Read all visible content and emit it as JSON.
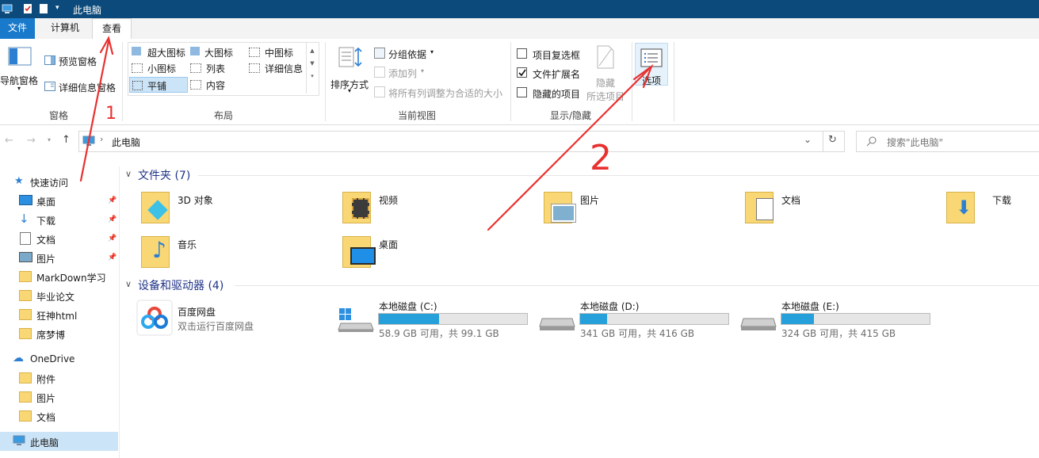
{
  "window": {
    "title": "此电脑"
  },
  "tabs": [
    "文件",
    "计算机",
    "查看"
  ],
  "ribbon": {
    "panes": {
      "nav_pane": "导航窗格",
      "preview_pane": "预览窗格",
      "details_pane": "详细信息窗格",
      "label": "窗格"
    },
    "layout": {
      "items": [
        "超大图标",
        "大图标",
        "中图标",
        "小图标",
        "列表",
        "详细信息",
        "平铺",
        "内容"
      ],
      "label": "布局"
    },
    "current_view": {
      "sort_by": "排序方式",
      "group_by": "分组依据",
      "add_columns": "添加列",
      "fit_columns": "将所有列调整为合适的大小",
      "label": "当前视图"
    },
    "show_hide": {
      "item_checkboxes": "项目复选框",
      "file_extensions": "文件扩展名",
      "hidden_items": "隐藏的项目",
      "hide_selected_1": "隐藏",
      "hide_selected_2": "所选项目",
      "label": "显示/隐藏"
    },
    "options": "选项"
  },
  "address": {
    "path": "此电脑",
    "search_placeholder": "搜索\"此电脑\""
  },
  "nav": {
    "quick_access": "快速访问",
    "quick_items": [
      "桌面",
      "下载",
      "文档",
      "图片",
      "MarkDown学习",
      "毕业论文",
      "狂神html",
      "席梦博"
    ],
    "onedrive": "OneDrive",
    "onedrive_items": [
      "附件",
      "图片",
      "文档"
    ],
    "this_pc": "此电脑"
  },
  "content": {
    "folders_title": "文件夹 (7)",
    "folders": [
      "3D 对象",
      "视频",
      "图片",
      "文档",
      "下载",
      "音乐",
      "桌面"
    ],
    "devices_title": "设备和驱动器 (4)",
    "baidu": {
      "name": "百度网盘",
      "sub": "双击运行百度网盘"
    },
    "drives": [
      {
        "name": "本地磁盘 (C:)",
        "info": "58.9 GB 可用，共 99.1 GB",
        "used_fraction": 0.406
      },
      {
        "name": "本地磁盘 (D:)",
        "info": "341 GB 可用，共 416 GB",
        "used_fraction": 0.18
      },
      {
        "name": "本地磁盘 (E:)",
        "info": "324 GB 可用，共 415 GB",
        "used_fraction": 0.219
      }
    ]
  },
  "annotations": {
    "mark_1": "1",
    "mark_2": "2"
  },
  "colors": {
    "accent": "#1979ca",
    "drive_bar": "#26a0da",
    "annotation": "#e8312f",
    "titlebar": "#0b4a7a"
  }
}
